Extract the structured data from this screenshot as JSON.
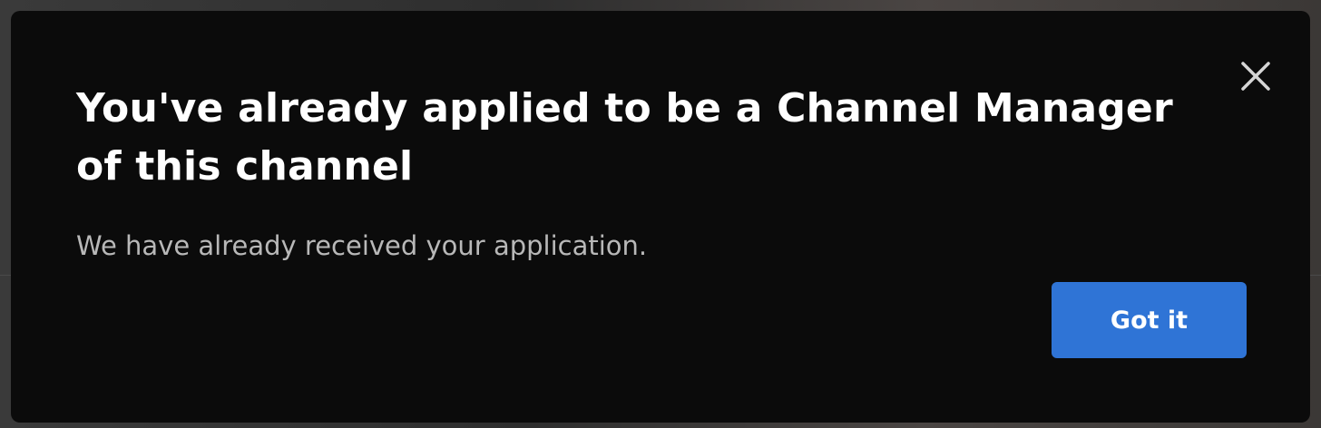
{
  "dialog": {
    "title": "You've already applied to be a Channel Manager of this channel",
    "message": "We have already received your application.",
    "primary_button_label": "Got it",
    "close_icon": "close-icon"
  },
  "colors": {
    "dialog_background": "#0b0b0b",
    "title_text": "#ffffff",
    "message_text": "#b8b8b8",
    "primary_button": "#2f74d6"
  }
}
